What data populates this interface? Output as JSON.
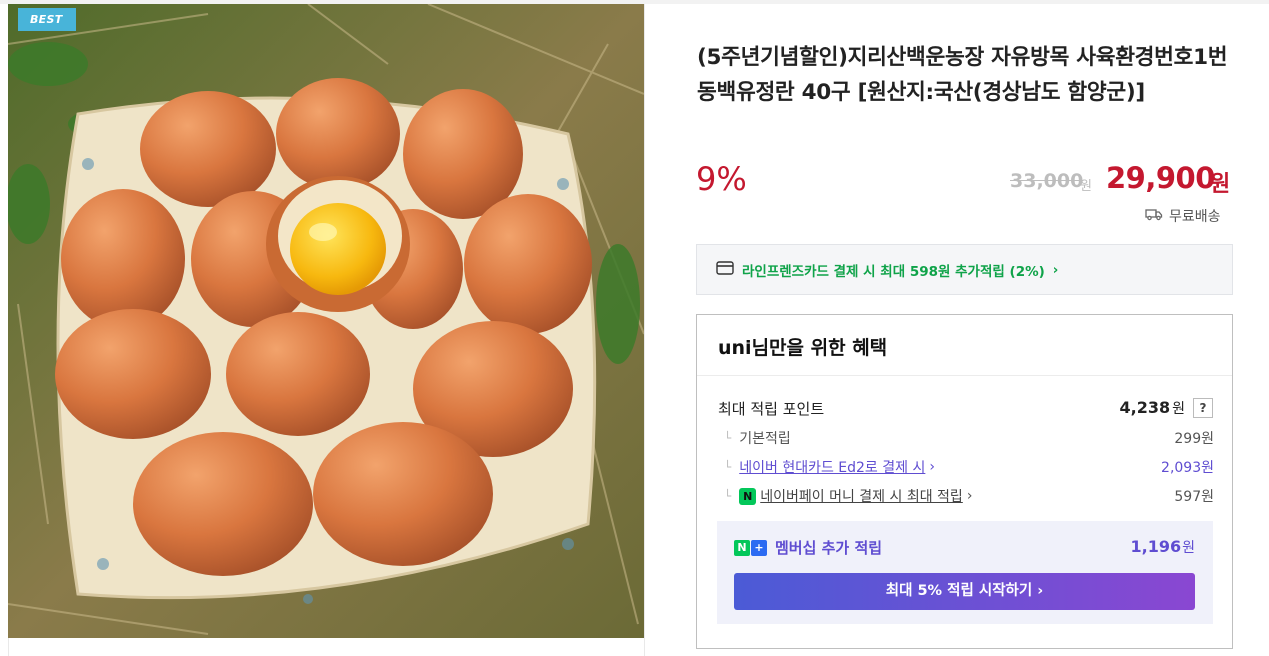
{
  "badge": "BEST",
  "product": {
    "title": "(5주년기념할인)지리산백운농장 자유방목 사육환경번호1번 동백유정란 40구 [원산지:국산(경상남도 함양군)]",
    "discount_rate": "9%",
    "original_price": "33,000",
    "original_price_unit": "원",
    "sale_price": "29,900",
    "sale_price_unit": "원",
    "delivery": "무료배송"
  },
  "card_promo": {
    "text": "라인프렌즈카드 결제 시 최대 598원 추가적립 (2%)",
    "arrow": "›"
  },
  "benefit": {
    "heading": "uni님만을 위한 혜택",
    "max_points_label": "최대 적립 포인트",
    "max_points_value": "4,238",
    "unit": "원",
    "help": "?",
    "rows": [
      {
        "label": "기본적립",
        "value": "299원"
      },
      {
        "label": "네이버 현대카드 Ed2로 결제 시",
        "value": "2,093원"
      },
      {
        "label": "네이버페이 머니 결제 시 최대 적립",
        "value": "597원"
      }
    ],
    "membership": {
      "label": "멤버십 추가 적립",
      "value": "1,196",
      "unit": "원",
      "button": "최대 5% 적립 시작하기 ›"
    }
  },
  "icons": {
    "delivery": "truck-icon",
    "card": "credit-card-icon",
    "npay": "naver-pay-icon",
    "nplus": "naver-plus-icon"
  },
  "colors": {
    "price_red": "#c4182f",
    "card_green": "#0fa349",
    "membership_purple": "#5f4dd1",
    "badge_blue": "#48b4d9"
  }
}
